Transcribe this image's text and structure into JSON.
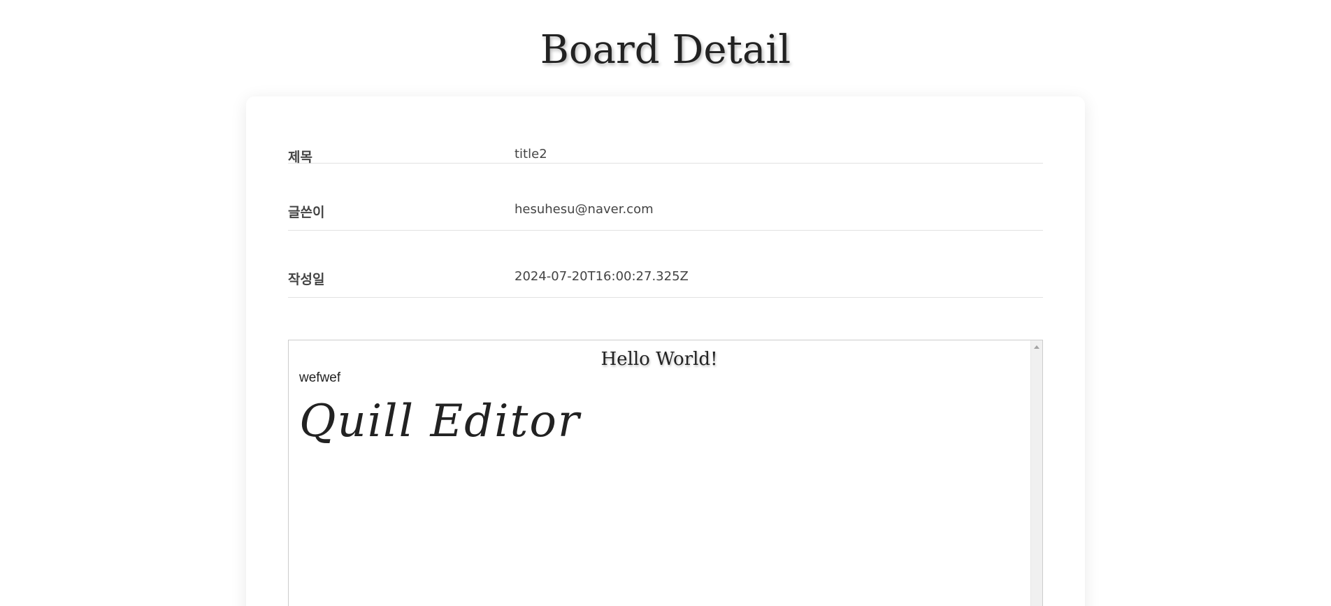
{
  "page": {
    "title": "Board Detail"
  },
  "details": {
    "title": {
      "label": "제목",
      "value": "title2"
    },
    "author": {
      "label": "글쓴이",
      "value": "hesuhesu@naver.com"
    },
    "created": {
      "label": "작성일",
      "value": "2024-07-20T16:00:27.325Z"
    }
  },
  "content": {
    "heading": "Hello World!",
    "paragraph": "wefwef",
    "script_text": "Quill Editor"
  },
  "scrollbar": {
    "up_icon": "chevron-up-icon"
  }
}
